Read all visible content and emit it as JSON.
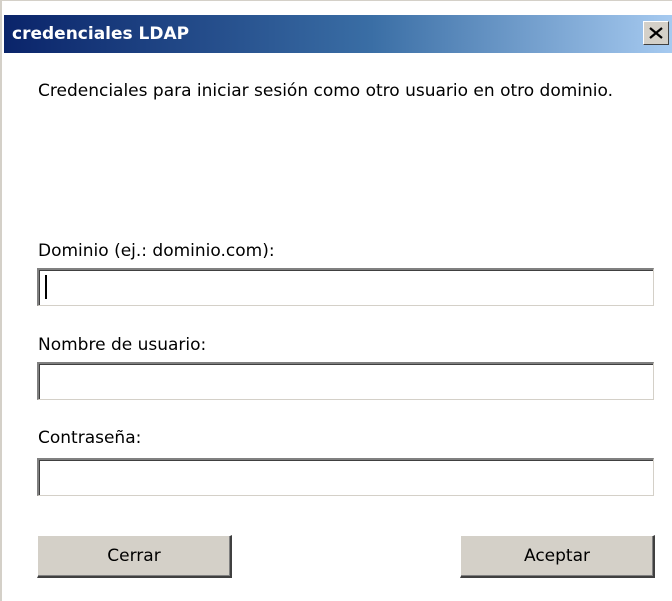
{
  "dialog": {
    "title": "credenciales LDAP",
    "close_glyph": "X",
    "message": "Credenciales para iniciar sesión como otro usuario en otro dominio."
  },
  "form": {
    "domain_label": "Dominio (ej.: dominio.com):",
    "domain_value": "",
    "username_label": "Nombre de usuario:",
    "username_value": "",
    "password_label": "Contraseña:",
    "password_value": ""
  },
  "buttons": {
    "close_label": "Cerrar",
    "accept_label": "Aceptar"
  },
  "colors": {
    "titlebar_start": "#0a246a",
    "titlebar_end": "#a6caf0",
    "button_face": "#d4d0c8"
  },
  "icons": {
    "close": "close-icon"
  }
}
